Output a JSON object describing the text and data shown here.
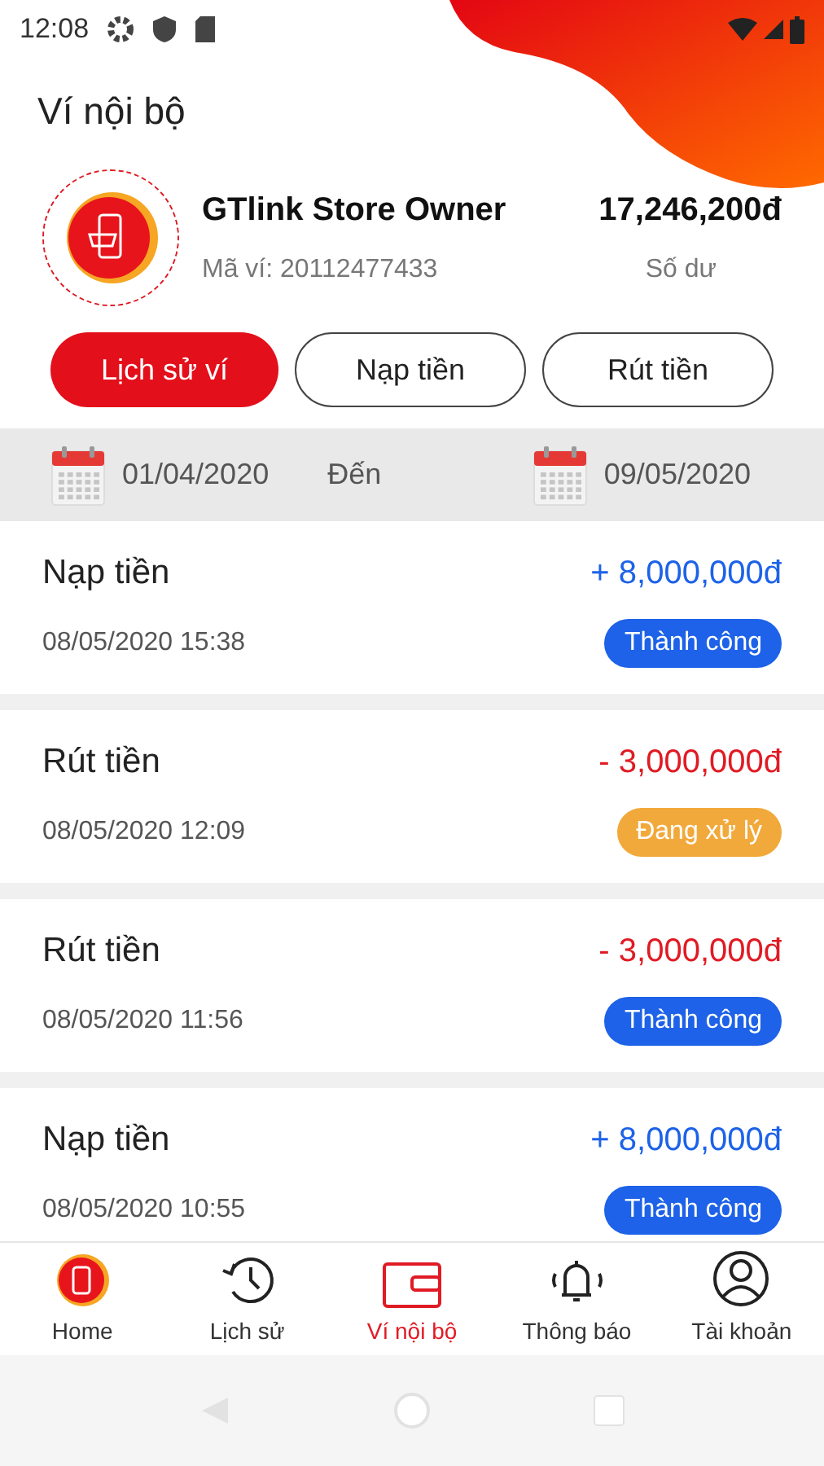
{
  "status_bar": {
    "time": "12:08"
  },
  "header": {
    "title": "Ví nội bộ"
  },
  "wallet": {
    "name": "GTlink Store Owner",
    "wallet_id": "Mã ví: 20112477433",
    "balance": "17,246,200đ",
    "balance_label": "Số dư"
  },
  "tabs": [
    {
      "label": "Lịch sử ví",
      "selected": true
    },
    {
      "label": "Nạp tiền",
      "selected": false
    },
    {
      "label": "Rút tiền",
      "selected": false
    }
  ],
  "date_range": {
    "from": "01/04/2020",
    "separator": "Đến",
    "to": "09/05/2020"
  },
  "transactions": [
    {
      "title": "Nạp tiền",
      "amount": "+ 8,000,000đ",
      "kind": "in",
      "time": "08/05/2020 15:38",
      "status": {
        "label": "Thành công",
        "kind": "success"
      }
    },
    {
      "title": "Rút tiền",
      "amount": "- 3,000,000đ",
      "kind": "out",
      "time": "08/05/2020 12:09",
      "status": {
        "label": "Đang xử lý",
        "kind": "pending"
      }
    },
    {
      "title": "Rút tiền",
      "amount": "- 3,000,000đ",
      "kind": "out",
      "time": "08/05/2020 11:56",
      "status": {
        "label": "Thành công",
        "kind": "success"
      }
    },
    {
      "title": "Nạp tiền",
      "amount": "+ 8,000,000đ",
      "kind": "in",
      "time": "08/05/2020 10:55",
      "status": {
        "label": "Thành công",
        "kind": "success"
      }
    }
  ],
  "bottom_nav": [
    {
      "label": "Home",
      "kind": "home",
      "selected": false
    },
    {
      "label": "Lịch sử",
      "kind": "history",
      "selected": false
    },
    {
      "label": "Ví nội bộ",
      "kind": "wallet",
      "selected": true
    },
    {
      "label": "Thông báo",
      "kind": "bell",
      "selected": false
    },
    {
      "label": "Tài khoản",
      "kind": "account",
      "selected": false
    }
  ]
}
